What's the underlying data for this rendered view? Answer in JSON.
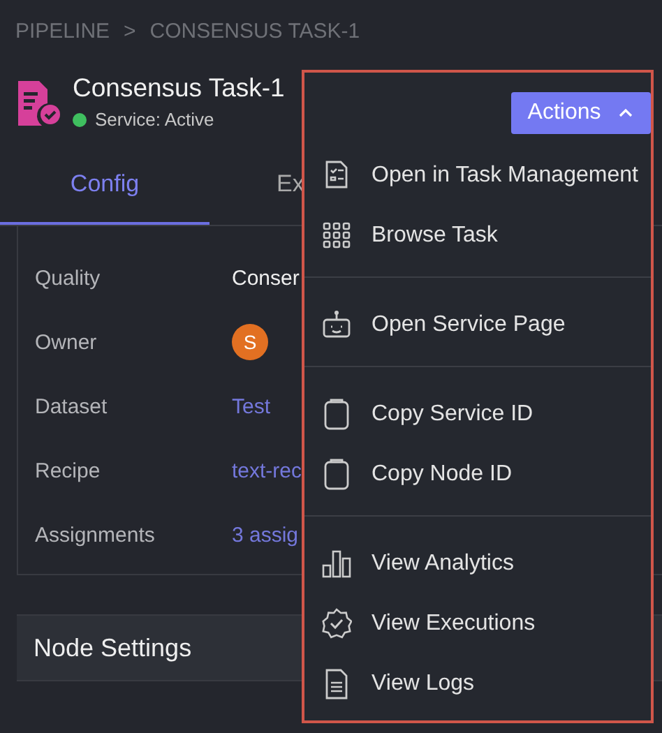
{
  "breadcrumb": [
    "PIPELINE",
    ">",
    "CONSENSUS TASK-1"
  ],
  "header": {
    "title": "Consensus Task-1",
    "status": {
      "label": "Service: Active",
      "color": "#3fbf5f"
    }
  },
  "tabs": [
    {
      "label": "Config",
      "selected": true
    },
    {
      "label": "Ex",
      "selected": false
    }
  ],
  "fields": [
    {
      "label": "Quality",
      "value": "Conser",
      "kind": "text"
    },
    {
      "label": "Owner",
      "value": "S",
      "kind": "avatar"
    },
    {
      "label": "Dataset",
      "value": "Test",
      "kind": "link"
    },
    {
      "label": "Recipe",
      "value": "text-rec",
      "kind": "link"
    },
    {
      "label": "Assignments",
      "value": "3 assig",
      "kind": "link"
    }
  ],
  "section": {
    "title": "Node Settings"
  },
  "actions": {
    "label": "Actions",
    "expanded": true,
    "groups": [
      [
        {
          "label": "Open in Task Management",
          "kind": "checklist"
        },
        {
          "label": "Browse Task",
          "kind": "grid"
        }
      ],
      [
        {
          "label": "Open Service Page",
          "kind": "robot"
        }
      ],
      [
        {
          "label": "Copy Service ID",
          "kind": "clipboard"
        },
        {
          "label": "Copy Node ID",
          "kind": "clipboard"
        }
      ],
      [
        {
          "label": "View Analytics",
          "kind": "bars"
        },
        {
          "label": "View Executions",
          "kind": "badge"
        },
        {
          "label": "View Logs",
          "kind": "document"
        }
      ]
    ]
  }
}
